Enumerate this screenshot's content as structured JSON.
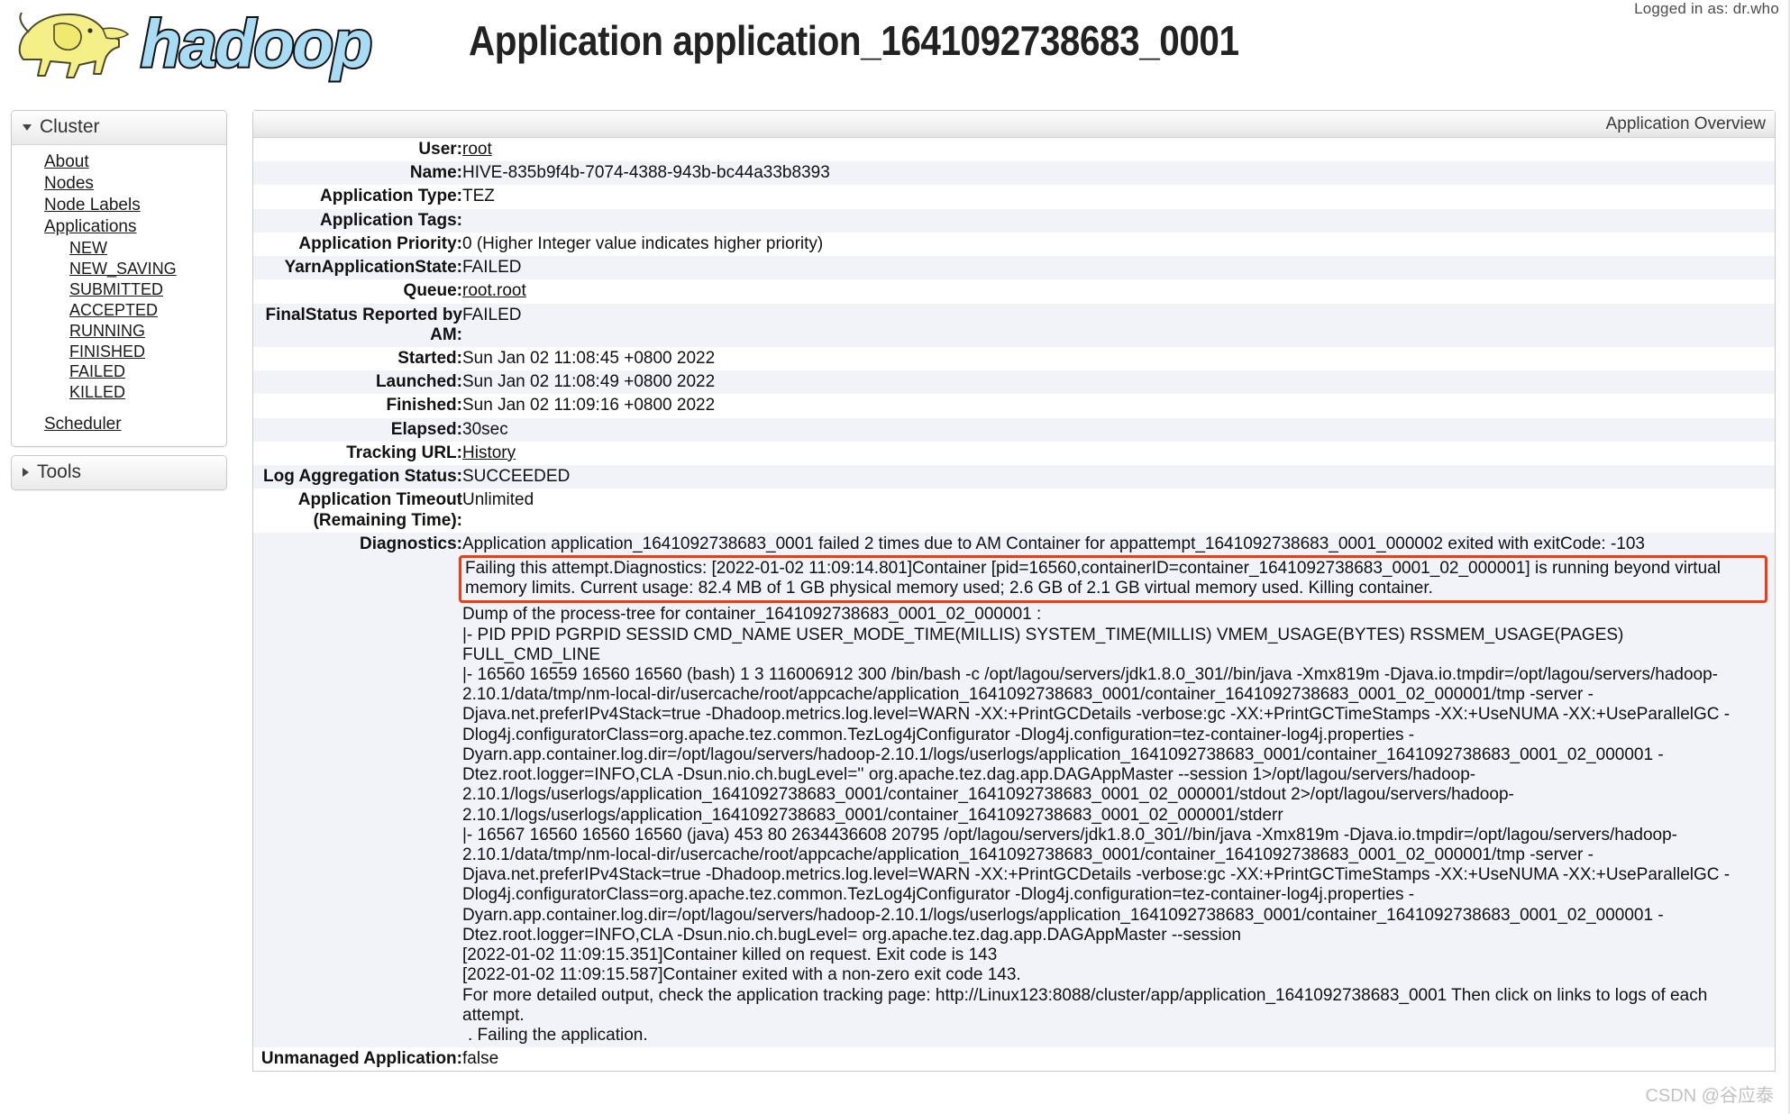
{
  "header": {
    "logged_in_as": "Logged in as: dr.who",
    "title": "Application application_1641092738683_0001",
    "logo_alt": "hadoop"
  },
  "sidebar": {
    "cluster": {
      "title": "Cluster",
      "items": [
        {
          "label": "About"
        },
        {
          "label": "Nodes"
        },
        {
          "label": "Node Labels"
        },
        {
          "label": "Applications"
        }
      ],
      "app_states": [
        {
          "label": "NEW"
        },
        {
          "label": "NEW_SAVING"
        },
        {
          "label": "SUBMITTED"
        },
        {
          "label": "ACCEPTED"
        },
        {
          "label": "RUNNING"
        },
        {
          "label": "FINISHED"
        },
        {
          "label": "FAILED"
        },
        {
          "label": "KILLED"
        }
      ],
      "scheduler": {
        "label": "Scheduler"
      }
    },
    "tools": {
      "title": "Tools"
    }
  },
  "main": {
    "section_title": "Application Overview",
    "rows": {
      "user_label": "User:",
      "user_value": "root",
      "name_label": "Name:",
      "name_value": "HIVE-835b9f4b-7074-4388-943b-bc44a33b8393",
      "app_type_label": "Application Type:",
      "app_type_value": "TEZ",
      "app_tags_label": "Application Tags:",
      "app_tags_value": "",
      "app_priority_label": "Application Priority:",
      "app_priority_value": "0 (Higher Integer value indicates higher priority)",
      "yarn_state_label": "YarnApplicationState:",
      "yarn_state_value": "FAILED",
      "queue_label": "Queue:",
      "queue_value": "root.root",
      "final_status_label": "FinalStatus Reported by AM:",
      "final_status_value": "FAILED",
      "started_label": "Started:",
      "started_value": "Sun Jan 02 11:08:45 +0800 2022",
      "launched_label": "Launched:",
      "launched_value": "Sun Jan 02 11:08:49 +0800 2022",
      "finished_label": "Finished:",
      "finished_value": "Sun Jan 02 11:09:16 +0800 2022",
      "elapsed_label": "Elapsed:",
      "elapsed_value": "30sec",
      "tracking_url_label": "Tracking URL:",
      "tracking_url_value": "History",
      "log_agg_label": "Log Aggregation Status:",
      "log_agg_value": "SUCCEEDED",
      "app_timeout_label": "Application Timeout (Remaining Time):",
      "app_timeout_value": "Unlimited",
      "diagnostics_label": "Diagnostics:",
      "unmanaged_label": "Unmanaged Application:",
      "unmanaged_value": "false"
    },
    "diagnostics": {
      "line1": "Application application_1641092738683_0001 failed 2 times due to AM Container for appattempt_1641092738683_0001_000002 exited with exitCode: -103",
      "highlight_line1": "Failing this attempt.Diagnostics: [2022-01-02 11:09:14.801]Container [pid=16560,containerID=container_1641092738683_0001_02_000001] is running beyond virtual",
      "highlight_line2": "memory limits. Current usage: 82.4 MB of 1 GB physical memory used; 2.6 GB of 2.1 GB virtual memory used. Killing container.",
      "lines": [
        "Dump of the process-tree for container_1641092738683_0001_02_000001 :",
        "|- PID PPID PGRPID SESSID CMD_NAME USER_MODE_TIME(MILLIS) SYSTEM_TIME(MILLIS) VMEM_USAGE(BYTES) RSSMEM_USAGE(PAGES)",
        "FULL_CMD_LINE",
        "|- 16560 16559 16560 16560 (bash) 1 3 116006912 300 /bin/bash -c /opt/lagou/servers/jdk1.8.0_301//bin/java -Xmx819m -Djava.io.tmpdir=/opt/lagou/servers/hadoop-",
        "2.10.1/data/tmp/nm-local-dir/usercache/root/appcache/application_1641092738683_0001/container_1641092738683_0001_02_000001/tmp -server -",
        "Djava.net.preferIPv4Stack=true -Dhadoop.metrics.log.level=WARN -XX:+PrintGCDetails -verbose:gc -XX:+PrintGCTimeStamps -XX:+UseNUMA -XX:+UseParallelGC -",
        "Dlog4j.configuratorClass=org.apache.tez.common.TezLog4jConfigurator -Dlog4j.configuration=tez-container-log4j.properties -",
        "Dyarn.app.container.log.dir=/opt/lagou/servers/hadoop-2.10.1/logs/userlogs/application_1641092738683_0001/container_1641092738683_0001_02_000001 -",
        "Dtez.root.logger=INFO,CLA -Dsun.nio.ch.bugLevel='' org.apache.tez.dag.app.DAGAppMaster --session 1>/opt/lagou/servers/hadoop-",
        "2.10.1/logs/userlogs/application_1641092738683_0001/container_1641092738683_0001_02_000001/stdout 2>/opt/lagou/servers/hadoop-",
        "2.10.1/logs/userlogs/application_1641092738683_0001/container_1641092738683_0001_02_000001/stderr",
        "|- 16567 16560 16560 16560 (java) 453 80 2634436608 20795 /opt/lagou/servers/jdk1.8.0_301//bin/java -Xmx819m -Djava.io.tmpdir=/opt/lagou/servers/hadoop-",
        "2.10.1/data/tmp/nm-local-dir/usercache/root/appcache/application_1641092738683_0001/container_1641092738683_0001_02_000001/tmp -server -",
        "Djava.net.preferIPv4Stack=true -Dhadoop.metrics.log.level=WARN -XX:+PrintGCDetails -verbose:gc -XX:+PrintGCTimeStamps -XX:+UseNUMA -XX:+UseParallelGC -",
        "Dlog4j.configuratorClass=org.apache.tez.common.TezLog4jConfigurator -Dlog4j.configuration=tez-container-log4j.properties -",
        "Dyarn.app.container.log.dir=/opt/lagou/servers/hadoop-2.10.1/logs/userlogs/application_1641092738683_0001/container_1641092738683_0001_02_000001 -",
        "Dtez.root.logger=INFO,CLA -Dsun.nio.ch.bugLevel= org.apache.tez.dag.app.DAGAppMaster --session",
        "[2022-01-02 11:09:15.351]Container killed on request. Exit code is 143",
        "[2022-01-02 11:09:15.587]Container exited with a non-zero exit code 143.",
        "For more detailed output, check the application tracking page: http://Linux123:8088/cluster/app/application_1641092738683_0001 Then click on links to logs of each",
        "attempt.",
        ". Failing the application."
      ]
    }
  },
  "watermark": "CSDN @谷应泰"
}
